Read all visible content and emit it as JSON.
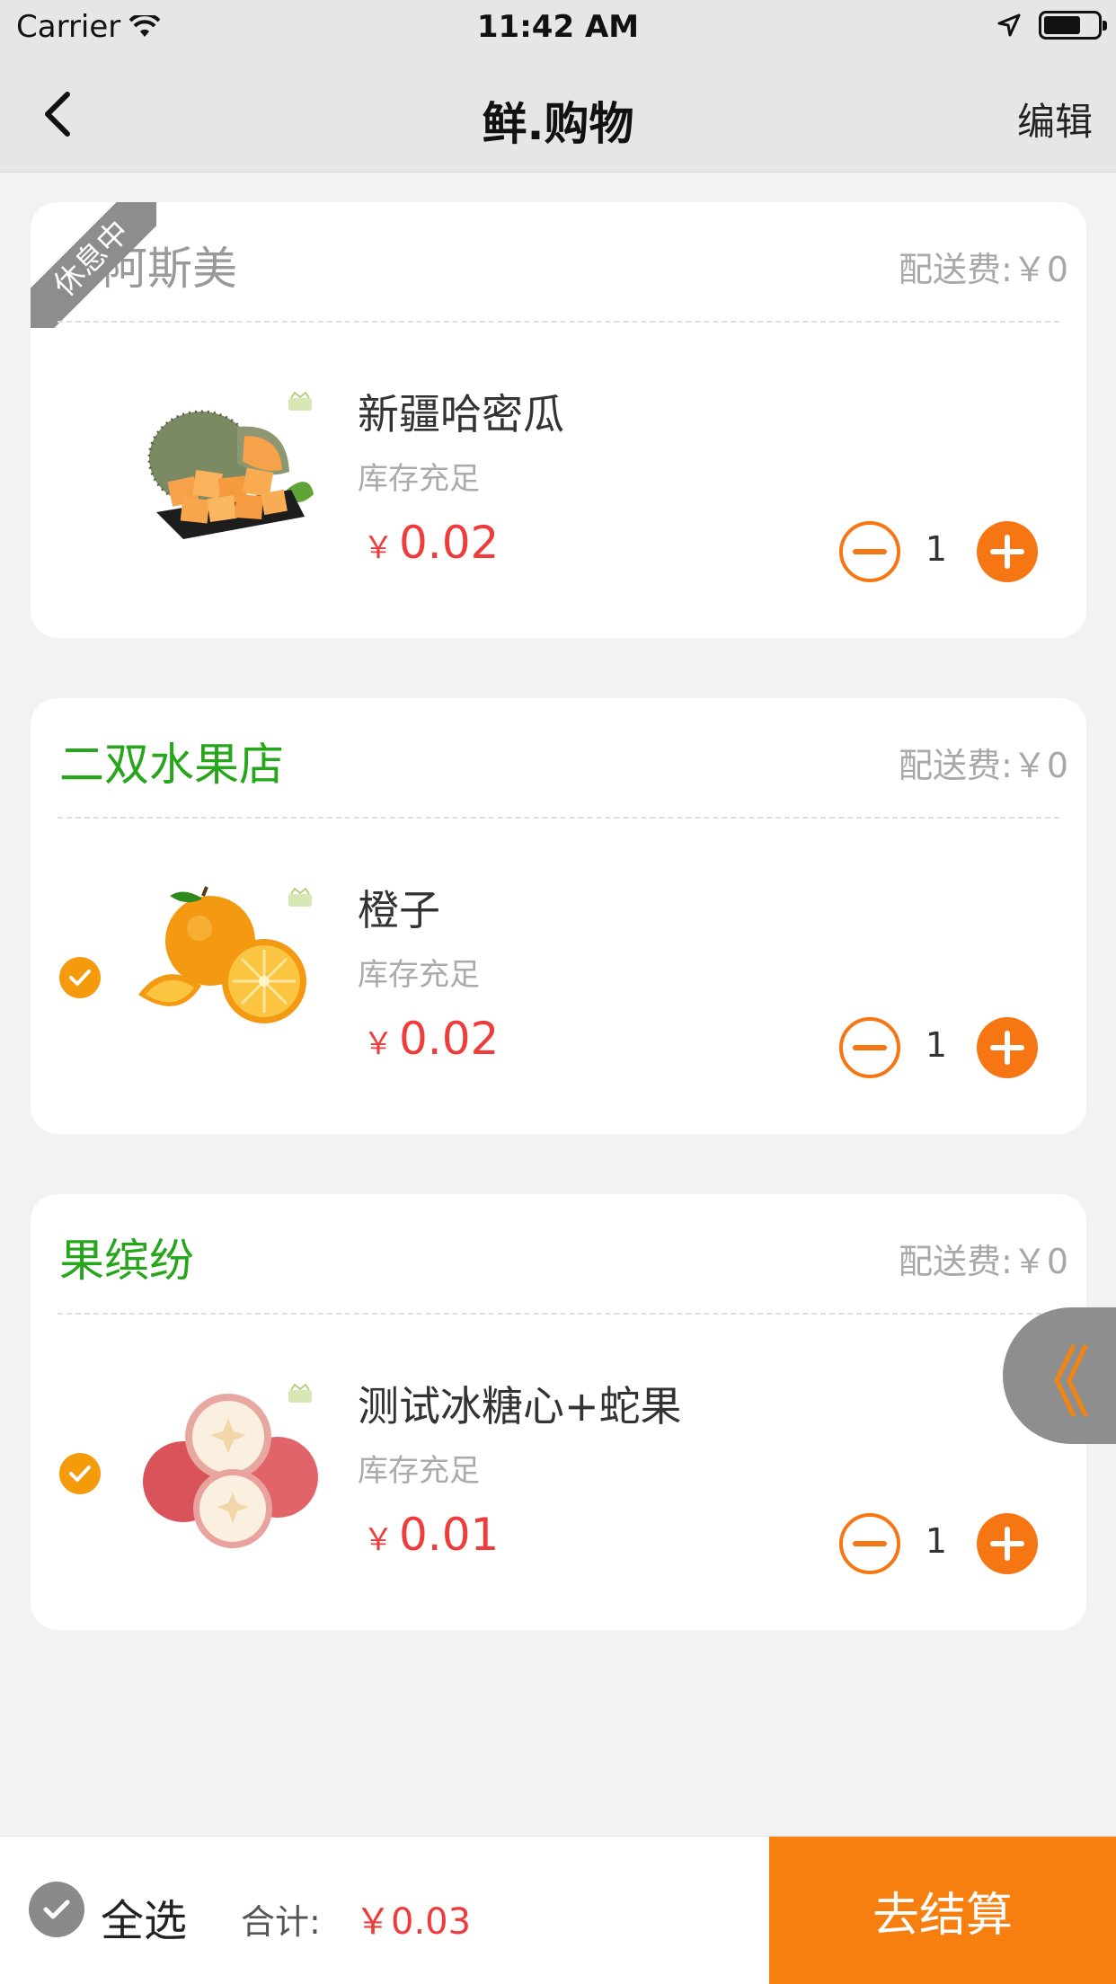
{
  "status_bar": {
    "carrier": "Carrier",
    "time": "11:42 AM"
  },
  "nav": {
    "title": "鲜.购物",
    "edit_label": "编辑"
  },
  "shops": [
    {
      "name": "阿斯美",
      "closed_badge": "休息中",
      "delivery_fee": "配送费:￥0",
      "selected": false,
      "item": {
        "name": "新疆哈密瓜",
        "stock": "库存充足",
        "currency": "￥",
        "price": "0.02",
        "quantity": "1",
        "image": "hami-melon-image"
      }
    },
    {
      "name": "二双水果店",
      "delivery_fee": "配送费:￥0",
      "selected": true,
      "item": {
        "name": "橙子",
        "stock": "库存充足",
        "currency": "￥",
        "price": "0.02",
        "quantity": "1",
        "image": "orange-image"
      }
    },
    {
      "name": "果缤纷",
      "delivery_fee": "配送费:￥0",
      "selected": true,
      "item": {
        "name": "测试冰糖心+蛇果",
        "stock": "库存充足",
        "currency": "￥",
        "price": "0.01",
        "quantity": "1",
        "image": "apple-image"
      }
    }
  ],
  "side_tab": {
    "glyph": "《"
  },
  "bottom_bar": {
    "select_all_label": "全选",
    "total_label": "合计:",
    "total_value": "￥0.03",
    "checkout_label": "去结算"
  },
  "colors": {
    "accent_orange": "#f57613",
    "checkout_orange": "#f77f10",
    "shop_green": "#26a61a",
    "price_red": "#ee3b3b",
    "check_orange": "#f59a0a"
  }
}
